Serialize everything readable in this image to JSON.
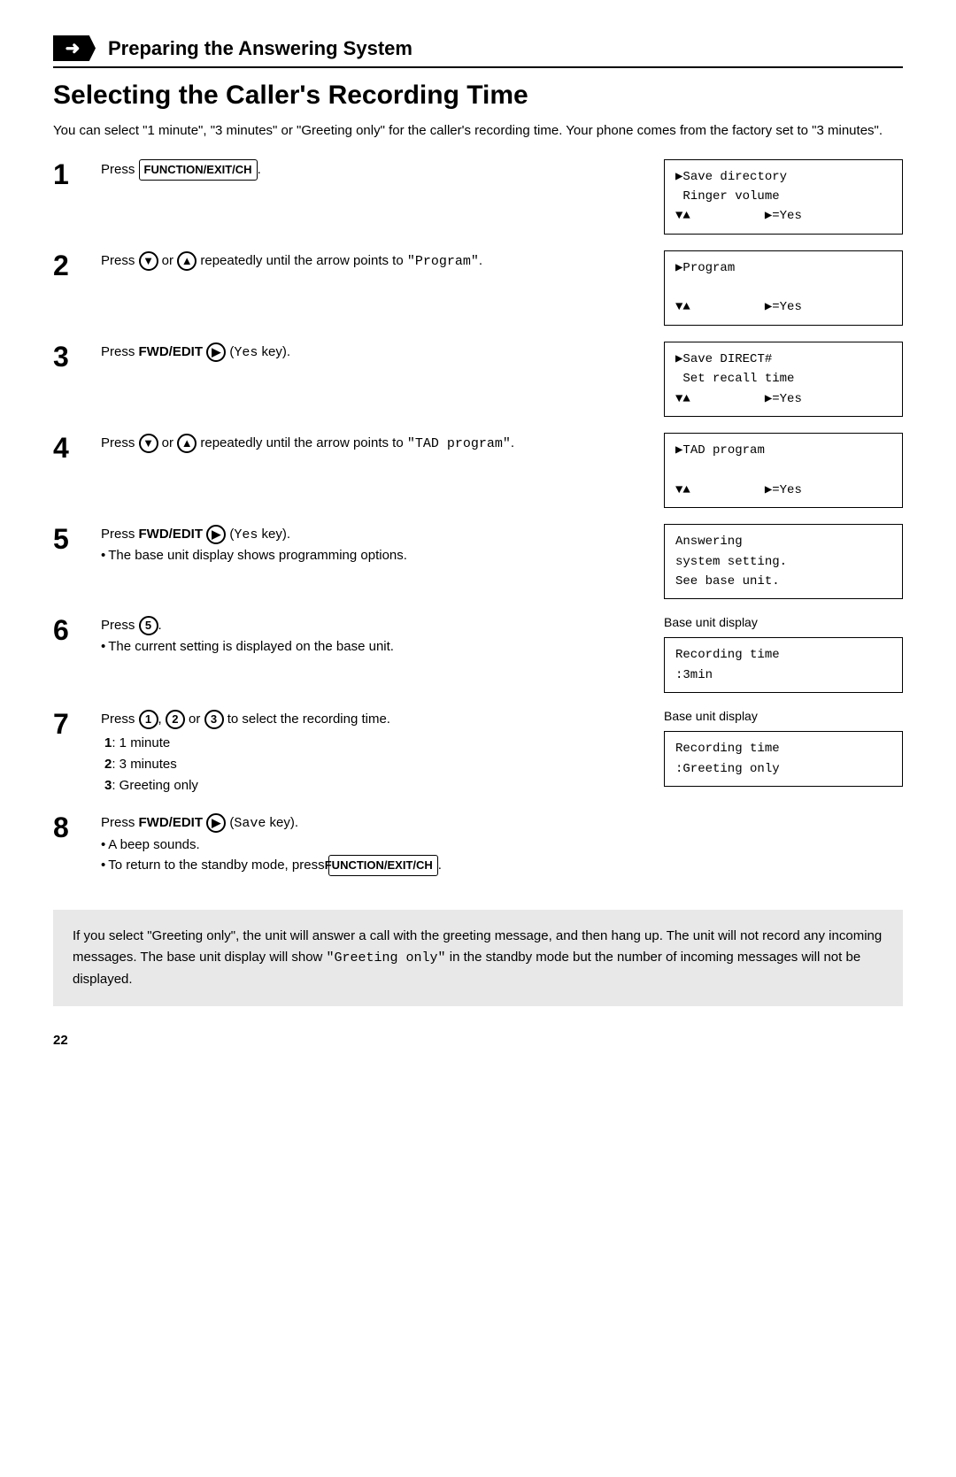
{
  "header": {
    "arrow_symbol": "➜",
    "title": "Preparing the Answering System"
  },
  "page_title": "Selecting the Caller's Recording Time",
  "intro": "You can select \"1 minute\", \"3 minutes\" or \"Greeting only\" for the caller's recording time. Your phone comes from the factory set to \"3 minutes\".",
  "steps": [
    {
      "number": "1",
      "instruction": "Press FUNCTION/EXIT/CH.",
      "display_lines": "▶Save directory\n Ringer volume\n▼▲          ▶=Yes"
    },
    {
      "number": "2",
      "instruction": "Press ▼ or ▲ repeatedly until the arrow points to \"Program\".",
      "display_lines": "▶Program\n\n▼▲          ▶=Yes"
    },
    {
      "number": "3",
      "instruction": "Press FWD/EDIT ▶ (Yes key).",
      "display_lines": "▶Save DIRECT#\n Set recall time\n▼▲          ▶=Yes"
    },
    {
      "number": "4",
      "instruction": "Press ▼ or ▲ repeatedly until the arrow points to \"TAD program\".",
      "display_lines": "▶TAD program\n\n▼▲          ▶=Yes"
    },
    {
      "number": "5",
      "instruction": "Press FWD/EDIT ▶ (Yes key).",
      "bullet": "The base unit display shows programming options.",
      "display_lines": "Answering\nsystem setting.\nSee base unit."
    },
    {
      "number": "6",
      "instruction": "Press 5.",
      "bullet": "The current setting is displayed on the base unit.",
      "display_label": "Base unit display",
      "display_lines": "Recording time\n:3min"
    },
    {
      "number": "7",
      "instruction": "Press 1, 2 or 3 to select the recording time.",
      "sub_items": [
        "1:  1 minute",
        "2:  3 minutes",
        "3:  Greeting only"
      ],
      "display_label": "Base unit display",
      "display_lines": "Recording time\n:Greeting only"
    },
    {
      "number": "8",
      "instruction": "Press FWD/EDIT ▶ (Save key).",
      "bullets": [
        "A beep sounds.",
        "To return to the standby mode, press FUNCTION/EXIT/CH."
      ]
    }
  ],
  "note": "If you select \"Greeting only\", the unit will answer a call with the greeting message, and then hang up. The unit will not record any incoming messages. The base unit display will show \"Greeting only\" in the standby mode but the number of incoming messages will not be displayed.",
  "page_number": "22",
  "labels": {
    "function_exit_ch": "FUNCTION/EXIT/CH",
    "fwd_edit": "FWD/EDIT",
    "yes_key": "Yes",
    "save_key": "Save",
    "base_unit_display": "Base unit display"
  }
}
